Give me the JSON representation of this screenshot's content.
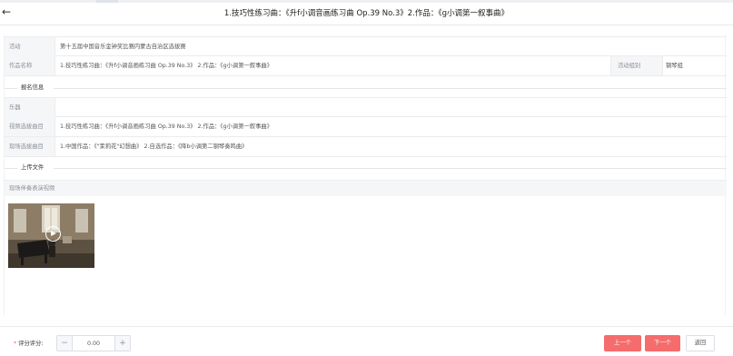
{
  "header": {
    "back_icon": "arrow-left-icon",
    "title": "1.技巧性练习曲：《升f小调音画练习曲 Op.39 No.3》2.作品：《g小调第一叙事曲》"
  },
  "info": {
    "activity_label": "活动",
    "activity_value": "第十五届中国音乐金钟奖比赛内蒙古自治区选拔赛",
    "work_label": "作品名称",
    "work_value": "1.技巧性练习曲：《升f小调音画练习曲 Op.39 No.3》 2.作品：《g小调第一叙事曲》",
    "group_label": "活动组别",
    "group_value": "钢琴组"
  },
  "registration": {
    "section_title": "报名信息",
    "instrument_label": "乐器",
    "instrument_value": "",
    "video_pieces_label": "视频选拔曲目",
    "video_pieces_value": "1.技巧性练习曲：《升f小调音画练习曲 Op.39 No.3》 2.作品：《g小调第一叙事曲》",
    "live_pieces_label": "现场选拔曲目",
    "live_pieces_value": "1.中国作品：《\"茉莉花\"幻想曲》 2.自选作品：《降b小调第二钢琴奏鸣曲》"
  },
  "uploads": {
    "section_title": "上传文件",
    "video_label": "现场伴奏表演视频",
    "play_icon": "play-circle-icon"
  },
  "footer": {
    "score_required_mark": "*",
    "score_label": "评分评分:",
    "score_value": "0.00",
    "minus_label": "−",
    "plus_label": "+",
    "prev_label": "上一个",
    "next_label": "下一个",
    "back_label": "返回"
  },
  "colors": {
    "accent": "#f56c6c",
    "label_bg": "#f5f6f8",
    "border": "#ececec"
  }
}
